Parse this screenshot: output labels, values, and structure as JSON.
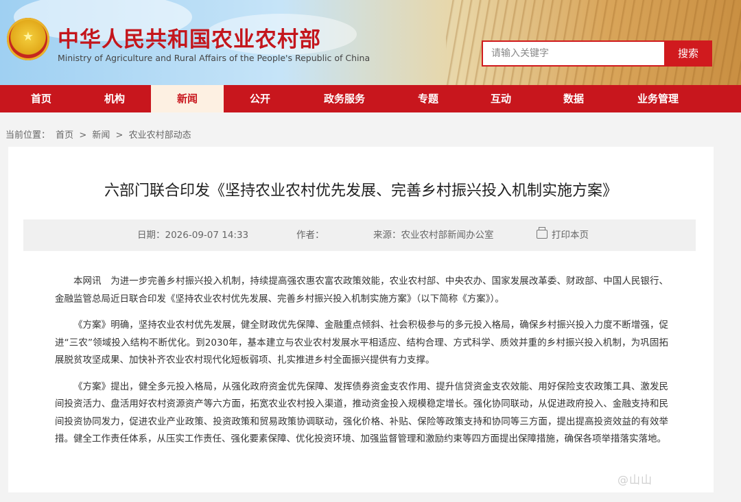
{
  "header": {
    "site_title_cn": "中华人民共和国农业农村部",
    "site_title_en": "Ministry of Agriculture and Rural Affairs of the People's Republic of China",
    "search_placeholder": "请输入关键字",
    "search_button": "搜索"
  },
  "nav": {
    "items": [
      {
        "label": "首页"
      },
      {
        "label": "机构"
      },
      {
        "label": "新闻",
        "active": true
      },
      {
        "label": "公开"
      },
      {
        "label": "政务服务"
      },
      {
        "label": "专题"
      },
      {
        "label": "互动"
      },
      {
        "label": "数据"
      },
      {
        "label": "业务管理"
      }
    ]
  },
  "breadcrumb": {
    "prefix": "当前位置：",
    "items": [
      "首页",
      ">",
      "新闻",
      ">",
      "农业农村部动态"
    ]
  },
  "article": {
    "title": "六部门联合印发《坚持农业农村优先发展、完善乡村振兴投入机制实施方案》",
    "meta": {
      "date": "日期：2026-09-07 14:33",
      "author": "作者：",
      "source": "来源：农业农村部新闻办公室",
      "print": "打印本页"
    },
    "paragraphs": [
      "本网讯　为进一步完善乡村振兴投入机制，持续提高强农惠农富农政策效能，农业农村部、中央农办、国家发展改革委、财政部、中国人民银行、金融监管总局近日联合印发《坚持农业农村优先发展、完善乡村振兴投入机制实施方案》（以下简称《方案》）。",
      "《方案》明确，坚持农业农村优先发展，健全财政优先保障、金融重点倾斜、社会积极参与的多元投入格局，确保乡村振兴投入力度不断增强，促进“三农”领域投入结构不断优化。到2030年，基本建立与农业农村发展水平相适应、结构合理、方式科学、质效并重的乡村振兴投入机制，为巩固拓展脱贫攻坚成果、加快补齐农业农村现代化短板弱项、扎实推进乡村全面振兴提供有力支撑。",
      "《方案》提出，健全多元投入格局，从强化政府资金优先保障、发挥债券资金支农作用、提升信贷资金支农效能、用好保险支农政策工具、激发民间投资活力、盘活用好农村资源资产等六方面，拓宽农业农村投入渠道，推动资金投入规模稳定增长。强化协同联动，从促进政府投入、金融支持和民间投资协同发力，促进农业产业政策、投资政策和贸易政策协调联动，强化价格、补贴、保险等政策支持和协同等三方面，提出提高投资效益的有效举措。健全工作责任体系，从压实工作责任、强化要素保障、优化投资环境、加强监督管理和激励约束等四方面提出保障措施，确保各项举措落实落地。"
    ]
  },
  "watermark": "@山山"
}
